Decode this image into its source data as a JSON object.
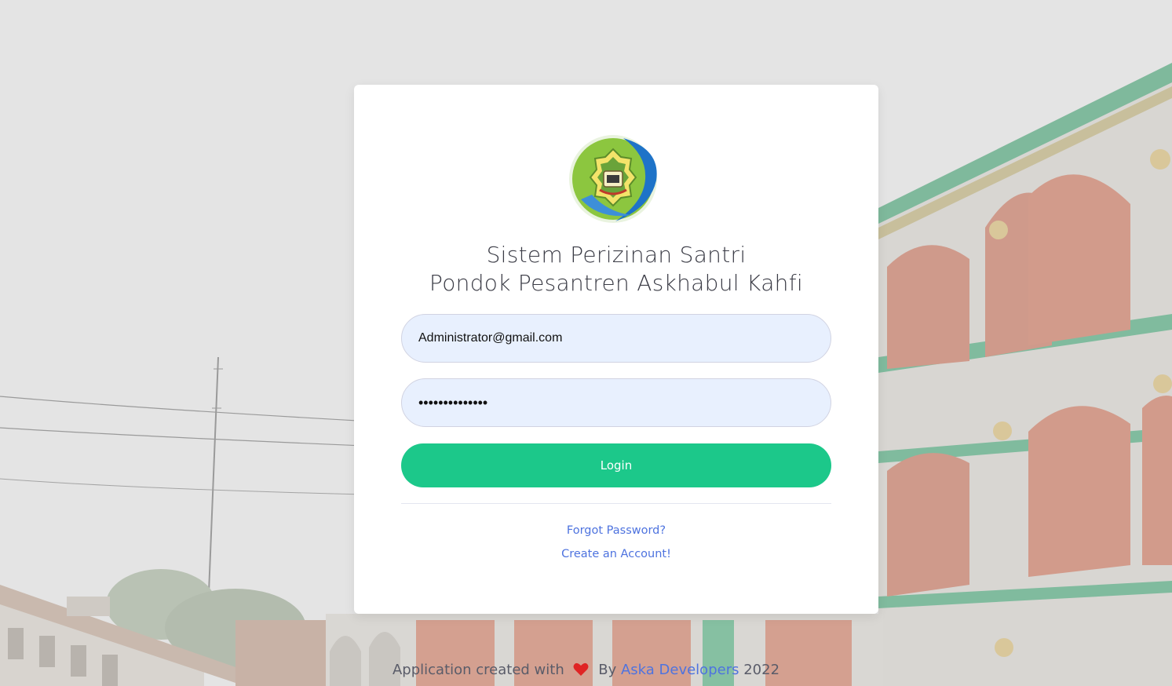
{
  "app": {
    "title_line1": "Sistem Perizinan Santri",
    "title_line2": "Pondok Pesantren Askhabul Kahfi",
    "logo_icon": "school-crest-logo"
  },
  "form": {
    "email_value": "Administrator@gmail.com",
    "password_value": "••••••••••••••",
    "login_label": "Login"
  },
  "links": {
    "forgot_password": "Forgot Password?",
    "create_account": "Create an Account!"
  },
  "footer": {
    "prefix": "Application created with",
    "heart_icon": "heart-icon",
    "by": "By",
    "developer": "Aska Developers",
    "year": "2022"
  },
  "colors": {
    "accent": "#1cc88a",
    "link": "#4e73df",
    "input_bg": "#e8f0fe",
    "heart": "#e02424"
  }
}
